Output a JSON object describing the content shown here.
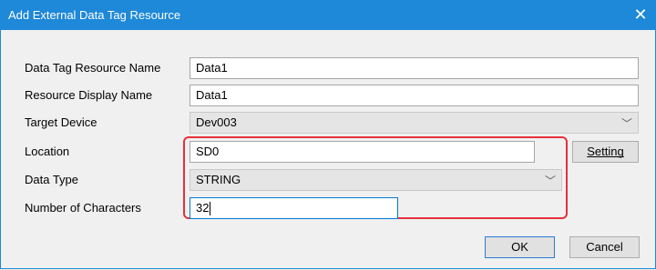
{
  "window": {
    "title": "Add External Data Tag Resource",
    "close_symbol": "✕"
  },
  "form": {
    "data_tag_resource_name": {
      "label": "Data Tag Resource Name",
      "value": "Data1"
    },
    "resource_display_name": {
      "label": "Resource Display Name",
      "value": "Data1"
    },
    "target_device": {
      "label": "Target Device",
      "value": "Dev003"
    },
    "location": {
      "label": "Location",
      "value": "SD0",
      "setting_button": "Setting"
    },
    "data_type": {
      "label": "Data Type",
      "value": "STRING"
    },
    "number_of_characters": {
      "label": "Number of Characters",
      "value": "32"
    }
  },
  "buttons": {
    "ok": "OK",
    "cancel": "Cancel"
  },
  "icons": {
    "chevron": "﹀"
  },
  "colors": {
    "titlebar": "#1e88d9",
    "highlight": "#e5313b"
  }
}
